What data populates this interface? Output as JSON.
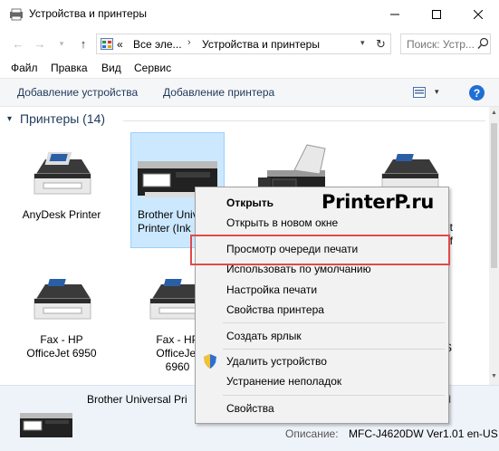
{
  "window": {
    "title": "Устройства и принтеры",
    "controls": {
      "minimize": "─",
      "maximize": "☐",
      "close": "✕"
    }
  },
  "nav": {
    "back": "←",
    "forward": "→",
    "recent": "▾",
    "up": "↑",
    "breadcrumb_prefix": "«",
    "crumbs": [
      "Все эле...",
      "Устройства и принтеры"
    ],
    "crumb_separator": "›",
    "dropdown": "▾",
    "refresh": "↻",
    "search_placeholder": "Поиск: Устр..."
  },
  "menu": {
    "items": [
      "Файл",
      "Правка",
      "Вид",
      "Сервис"
    ]
  },
  "commands": {
    "add_device": "Добавление устройства",
    "add_printer": "Добавление принтера",
    "view_dropdown": "▾",
    "help": "?"
  },
  "group": {
    "chevron": "▾",
    "label": "Принтеры (14)"
  },
  "devices": [
    {
      "label": "AnyDesk Printer",
      "icon": "printer-icon"
    },
    {
      "label": "Brother Universal Printer (Inkjet)",
      "line1": "Brother Univ",
      "line2": "Printer (Ink",
      "icon": "printer-icon",
      "selected": true
    },
    {
      "label": "",
      "icon": "fax-icon"
    },
    {
      "label_tail": "et",
      "label_tail2": "9f",
      "icon": "printer-icon"
    },
    {
      "label": "Fax - HP OfficeJet 6950",
      "line1": "Fax - HP",
      "line2": "OfficeJet 6950",
      "icon": "printer-icon"
    },
    {
      "label": "Fax - HP OfficeJet 6960",
      "line1": "Fax - HP",
      "line2": "OfficeJet",
      "line3": "6960",
      "icon": "printer-icon"
    },
    {
      "label_tail": "S",
      "icon": "printer-icon"
    }
  ],
  "context_menu": {
    "items": [
      {
        "label": "Открыть",
        "bold": true
      },
      {
        "label": "Открыть в новом окне"
      },
      {
        "label": "Просмотр очереди печати",
        "highlighted": true
      },
      {
        "label": "Использовать по умолчанию"
      },
      {
        "label": "Настройка печати"
      },
      {
        "label": "Свойства принтера"
      },
      {
        "label": "Создать ярлык"
      },
      {
        "label": "Удалить устройство",
        "icon": "shield-icon"
      },
      {
        "label": "Устранение неполадок"
      },
      {
        "label": "Свойства"
      }
    ]
  },
  "watermark": "PrinterP.ru",
  "details": {
    "name": "Brother Universal Pri",
    "name_tail": "td",
    "description_label": "Описание:",
    "description_value": "MFC-J4620DW Ver1.01 en-US"
  },
  "colors": {
    "accent": "#1e395b",
    "selection": "#cce8ff",
    "highlight_border": "#e0494b",
    "details_bg": "#eef3fa",
    "menu_bg": "#f2f2f2"
  }
}
